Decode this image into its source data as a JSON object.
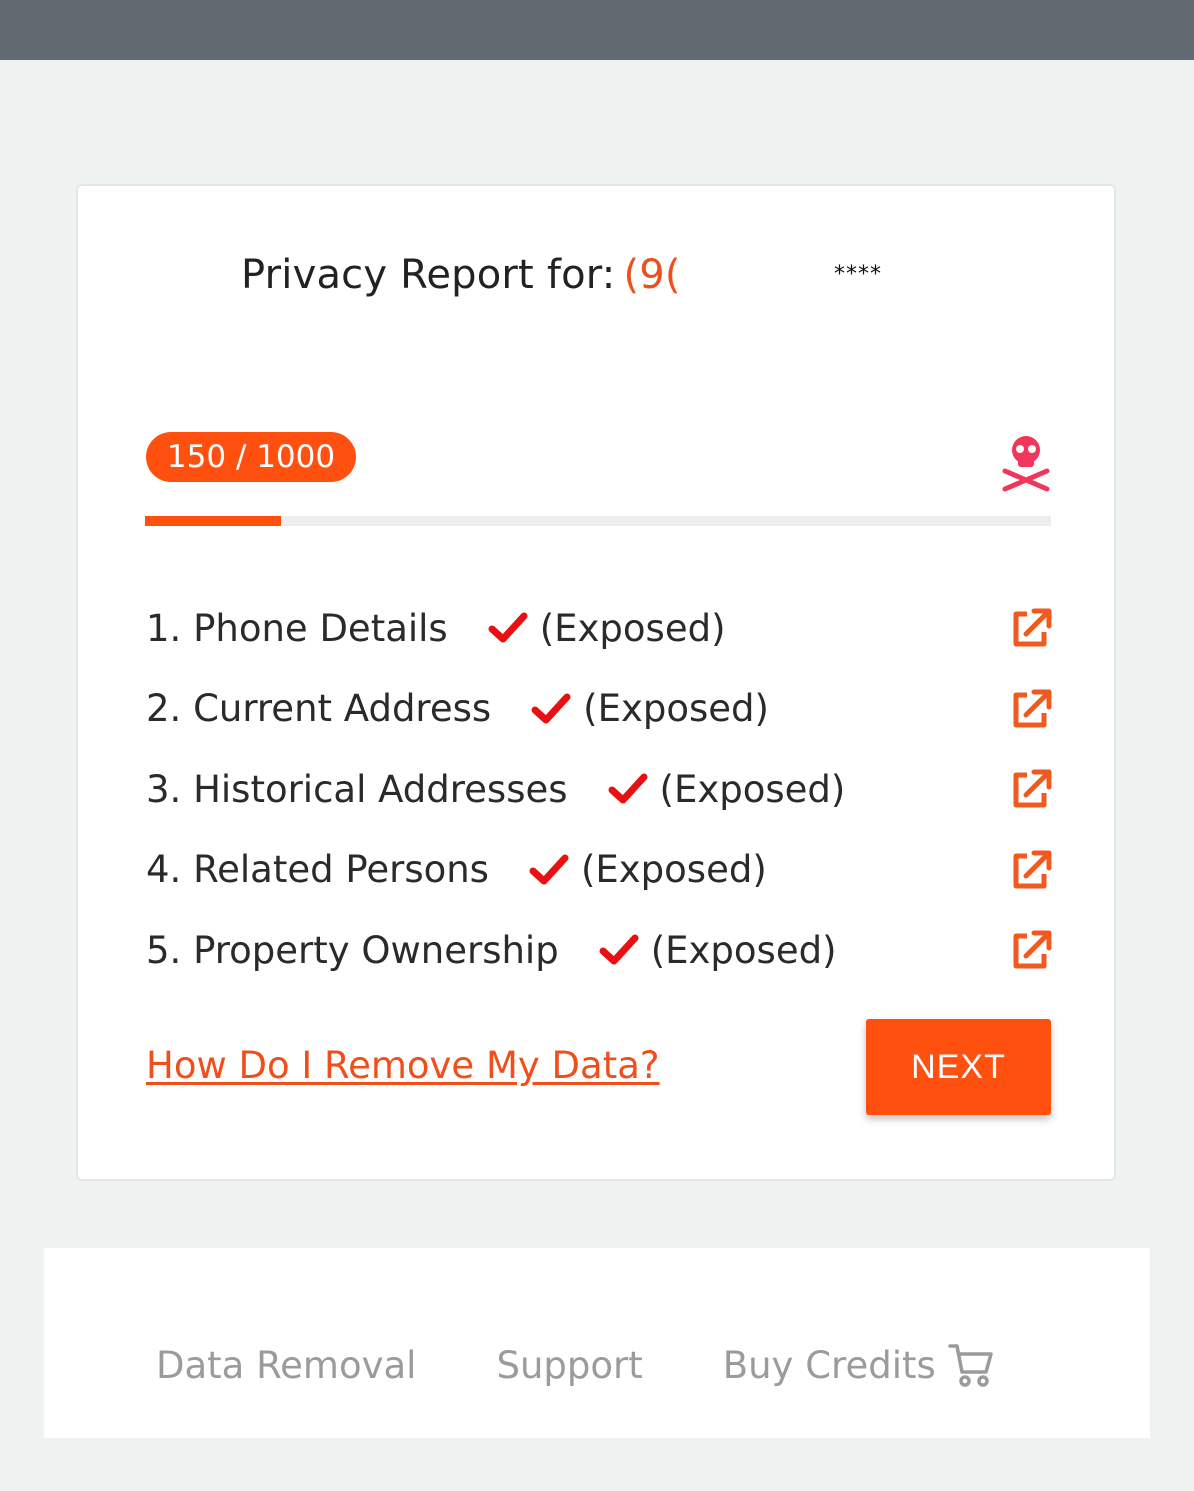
{
  "report": {
    "title_prefix": "Privacy Report for:",
    "phone_partial": "(9(",
    "mask": "****"
  },
  "score": {
    "label": "150 / 1000",
    "value": 150,
    "max": 1000
  },
  "items": [
    {
      "label": "1. Phone Details",
      "status": "(Exposed)"
    },
    {
      "label": "2. Current Address",
      "status": "(Exposed)"
    },
    {
      "label": "3. Historical Addresses",
      "status": "(Exposed)"
    },
    {
      "label": "4. Related Persons",
      "status": "(Exposed)"
    },
    {
      "label": "5. Property Ownership",
      "status": "(Exposed)"
    }
  ],
  "actions": {
    "remove_link": "How Do I Remove My Data?",
    "next_label": "NEXT"
  },
  "footer": {
    "data_removal": "Data Removal",
    "support": "Support",
    "buy_credits": "Buy Credits"
  },
  "colors": {
    "accent": "#ff5010",
    "check": "#e81010",
    "skull": "#f0365a",
    "topbar": "#606a70"
  },
  "icons": {
    "danger": "skull-crossbones-icon",
    "exposed": "checkmark-icon",
    "open": "external-link-icon",
    "cart": "shopping-cart-icon"
  }
}
